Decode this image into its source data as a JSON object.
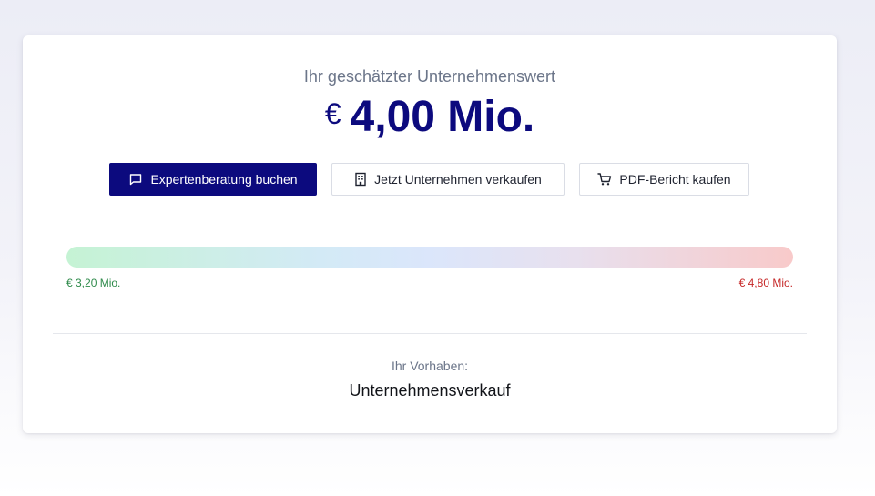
{
  "valuation": {
    "subtitle": "Ihr geschätzter Unternehmenswert",
    "currency_symbol": "€",
    "amount": "4,00 Mio."
  },
  "actions": {
    "expert_label": "Expertenberatung buchen",
    "expert_icon": "chat-bubble-icon",
    "sell_label": "Jetzt Unternehmen verkaufen",
    "sell_icon": "building-icon",
    "pdf_label": "PDF-Bericht kaufen",
    "pdf_icon": "cart-icon"
  },
  "range": {
    "low_label": "€ 3,20 Mio.",
    "high_label": "€ 4,80 Mio.",
    "low_color": "#2e8a4a",
    "high_color": "#c62828"
  },
  "plan": {
    "label": "Ihr Vorhaben:",
    "value": "Unternehmensverkauf"
  },
  "colors": {
    "brand": "#0c0a7e",
    "muted_text": "#6b7589"
  }
}
